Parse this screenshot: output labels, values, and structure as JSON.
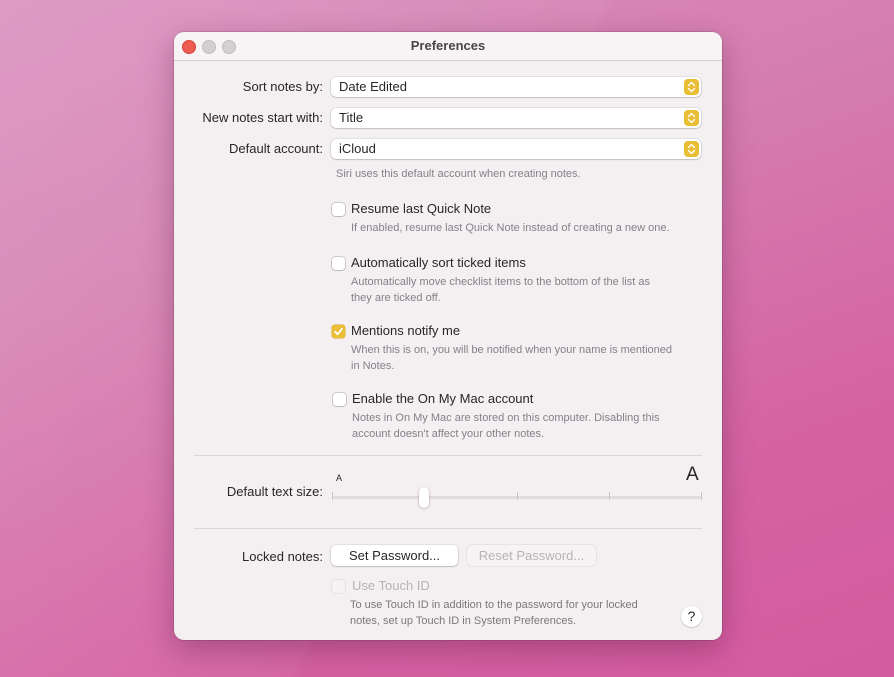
{
  "window": {
    "title": "Preferences",
    "controls": [
      "close",
      "minimize",
      "zoom"
    ]
  },
  "colors": {
    "accent": "#e9be35",
    "close": "#ee5b52",
    "window_bg": "#f4eff1"
  },
  "general": {
    "sort_notes_by": {
      "label": "Sort notes by:",
      "value": "Date Edited"
    },
    "new_notes_start_with": {
      "label": "New notes start with:",
      "value": "Title"
    },
    "default_account": {
      "label": "Default account:",
      "value": "iCloud",
      "hint": "Siri uses this default account when creating notes."
    }
  },
  "options": [
    {
      "label": "Resume last Quick Note",
      "checked": false,
      "hint_lines": [
        "If enabled, resume last Quick Note instead of creating a new one."
      ]
    },
    {
      "label": "Automatically sort ticked items",
      "checked": false,
      "hint_lines": [
        "Automatically move checklist items to the bottom of the list as",
        "they are ticked off."
      ]
    },
    {
      "label": "Mentions notify me",
      "checked": true,
      "hint_lines": [
        "When this is on, you will be notified when your name is mentioned",
        "in Notes."
      ]
    },
    {
      "label": "Enable the On My Mac account",
      "checked": false,
      "hint_lines": [
        "Notes in On My Mac are stored on this computer. Disabling this",
        "account doesn't affect your other notes."
      ]
    }
  ],
  "text_size": {
    "label": "Default text size:",
    "small_glyph": "A",
    "large_glyph": "A",
    "steps": 5,
    "selected_step_index": 1,
    "fraction": 0.25
  },
  "locked_notes": {
    "label": "Locked notes:",
    "set_password": "Set Password...",
    "reset_password": "Reset Password...",
    "reset_enabled": false,
    "touch_id": {
      "label": "Use Touch ID",
      "checked": false,
      "enabled": false,
      "hint_lines": [
        "To use Touch ID in addition to the password for your locked",
        "notes, set up Touch ID in System Preferences."
      ]
    }
  },
  "help": {
    "label": "?"
  }
}
